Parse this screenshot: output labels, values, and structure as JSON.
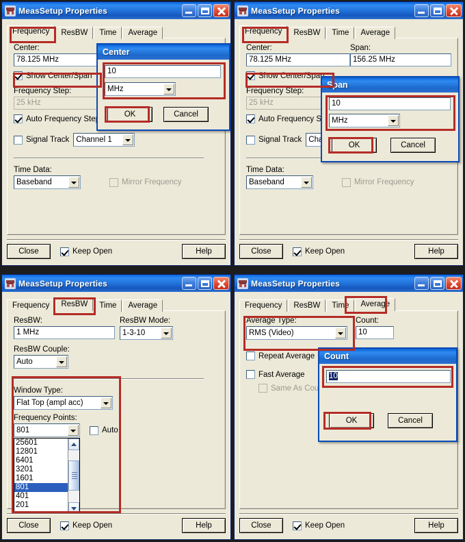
{
  "window": {
    "title": "MeasSetup Properties",
    "icon": "app-icon",
    "buttons": {
      "minimize": "minimize",
      "maximize": "maximize",
      "close": "close"
    }
  },
  "tabs": [
    "Frequency",
    "ResBW",
    "Time",
    "Average"
  ],
  "footer": {
    "close": "Close",
    "keep_open": "Keep Open",
    "help": "Help",
    "keep_open_checked": true
  },
  "panels": [
    {
      "id": "panel-frequency-center",
      "active_tab": "Frequency",
      "frequency": {
        "center_label": "Center:",
        "center_value": "78.125 MHz",
        "show_center_span_label": "Show Center/Span",
        "show_center_span_checked": true,
        "freq_step_label": "Frequency Step:",
        "freq_step_value": "25 kHz",
        "freq_step_disabled": true,
        "auto_freq_step_label": "Auto Frequency Step",
        "auto_freq_step_checked": true,
        "signal_track_label": "Signal Track",
        "signal_track_checked": false,
        "signal_track_channel": "Channel 1",
        "time_data_label": "Time Data:",
        "time_data_value": "Baseband",
        "mirror_frequency_label": "Mirror Frequency",
        "mirror_frequency_checked": false,
        "mirror_frequency_disabled": true
      },
      "popup": {
        "title": "Center",
        "value": "10",
        "unit": "MHz",
        "ok": "OK",
        "cancel": "Cancel",
        "value_selected": false
      }
    },
    {
      "id": "panel-frequency-span",
      "active_tab": "Frequency",
      "frequency": {
        "center_label": "Center:",
        "center_value": "78.125 MHz",
        "span_label": "Span:",
        "span_value": "156.25 MHz",
        "show_center_span_label": "Show Center/Span",
        "show_center_span_checked": true,
        "freq_step_label": "Frequency Step:",
        "freq_step_value": "25 kHz",
        "freq_step_disabled": true,
        "auto_freq_step_label": "Auto Frequency Step",
        "auto_freq_step_checked": true,
        "signal_track_label": "Signal Track",
        "signal_track_checked": false,
        "signal_track_channel": "Chann",
        "time_data_label": "Time Data:",
        "time_data_value": "Baseband",
        "mirror_frequency_label": "Mirror Frequency",
        "mirror_frequency_checked": false,
        "mirror_frequency_disabled": true
      },
      "popup": {
        "title": "Span",
        "value": "10",
        "unit": "MHz",
        "ok": "OK",
        "cancel": "Cancel",
        "value_selected": false
      }
    },
    {
      "id": "panel-resbw",
      "active_tab": "ResBW",
      "resbw": {
        "resbw_label": "ResBW:",
        "resbw_value": "1 MHz",
        "resbw_mode_label": "ResBW Mode:",
        "resbw_mode_value": "1-3-10",
        "resbw_couple_label": "ResBW Couple:",
        "resbw_couple_value": "Auto",
        "window_type_label": "Window Type:",
        "window_type_value": "Flat Top  (ampl acc)",
        "frequency_points_label": "Frequency Points:",
        "frequency_points_value": "801",
        "auto_label": "Auto",
        "auto_checked": false,
        "frequency_points_options": [
          "25601",
          "12801",
          "6401",
          "3201",
          "1601",
          "801",
          "401",
          "201"
        ],
        "frequency_points_selected": "801"
      }
    },
    {
      "id": "panel-average",
      "active_tab": "Average",
      "average": {
        "average_type_label": "Average Type:",
        "average_type_value": "RMS (Video)",
        "count_label": "Count:",
        "count_value": "10",
        "repeat_average_label": "Repeat Average",
        "repeat_average_checked": false,
        "fast_average_label": "Fast Average",
        "fast_average_checked": false,
        "same_as_count_label": "Same As Count",
        "same_as_count_checked": false,
        "same_as_count_disabled": true
      },
      "popup": {
        "title": "Count",
        "value": "10",
        "ok": "OK",
        "cancel": "Cancel",
        "value_selected": true
      }
    }
  ],
  "colors": {
    "annotation": "#b42c26",
    "titlebar": "#1b76e8",
    "face": "#ece9d8",
    "selection": "#2a5fbe"
  }
}
